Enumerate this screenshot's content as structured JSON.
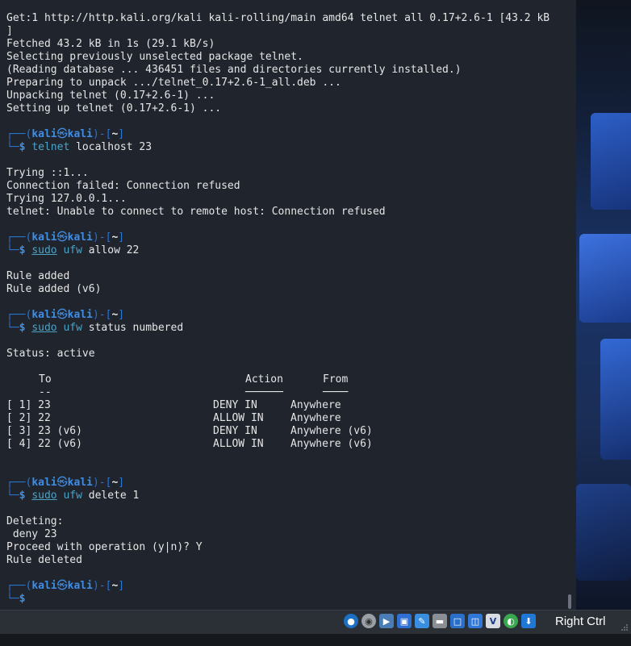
{
  "terminal": {
    "lines": {
      "l0": "Get:1 http://http.kali.org/kali kali-rolling/main amd64 telnet all 0.17+2.6-1 [43.2 kB",
      "l1": "]",
      "l2": "Fetched 43.2 kB in 1s (29.1 kB/s)",
      "l3": "Selecting previously unselected package telnet.",
      "l4": "(Reading database ... 436451 files and directories currently installed.)",
      "l5": "Preparing to unpack .../telnet_0.17+2.6-1_all.deb ...",
      "l6": "Unpacking telnet (0.17+2.6-1) ...",
      "l7": "Setting up telnet (0.17+2.6-1) ...",
      "l12": "Trying ::1...",
      "l13": "Connection failed: Connection refused",
      "l14": "Trying 127.0.0.1...",
      "l15": "telnet: Unable to connect to remote host: Connection refused",
      "l20": "Rule added",
      "l21": "Rule added (v6)",
      "l26": "Status: active",
      "l38": "Deleting:",
      "l39": " deny 23",
      "l40": "Proceed with operation (y|n)? Y",
      "l41": "Rule deleted"
    },
    "prompt": {
      "open": "┌──(",
      "user": "kali",
      "at": "㉿",
      "host": "kali",
      "mid": ")-[",
      "dir": "~",
      "close": "]",
      "corner": "└─",
      "dollar": "$"
    },
    "commands": {
      "c1": {
        "cmd": "telnet",
        "args": " localhost 23"
      },
      "c2": {
        "sudo": "sudo",
        "cmd": "ufw",
        "args": " allow 22"
      },
      "c3": {
        "sudo": "sudo",
        "cmd": "ufw",
        "args": " status numbered"
      },
      "c4": {
        "sudo": "sudo",
        "cmd": "ufw",
        "args": " delete 1"
      }
    },
    "ufw_table": {
      "headers": {
        "to": "To",
        "action": "Action",
        "from": "From"
      },
      "underlines": {
        "to": "--",
        "action": "──────",
        "from": "────"
      },
      "rows": [
        {
          "to": "[ 1] 23",
          "action": "DENY IN",
          "from": "Anywhere"
        },
        {
          "to": "[ 2] 22",
          "action": "ALLOW IN",
          "from": "Anywhere"
        },
        {
          "to": "[ 3] 23 (v6)",
          "action": "DENY IN",
          "from": "Anywhere (v6)"
        },
        {
          "to": "[ 4] 22 (v6)",
          "action": "ALLOW IN",
          "from": "Anywhere (v6)"
        }
      ]
    }
  },
  "statusbar": {
    "host_key": "Right Ctrl",
    "icons": [
      "hard-disk-icon",
      "optical-drive-icon",
      "audio-icon",
      "network-icon",
      "usb-icon",
      "shared-folders-icon",
      "display-icon",
      "recording-icon",
      "cpu-icon",
      "mouse-integration-icon",
      "host-key-indicator-icon"
    ]
  },
  "colors": {
    "terminal_bg": "#1f242d",
    "prompt_blue": "#3f8ee6",
    "command_cyan": "#4da3c7",
    "text": "#e6e6e6"
  }
}
